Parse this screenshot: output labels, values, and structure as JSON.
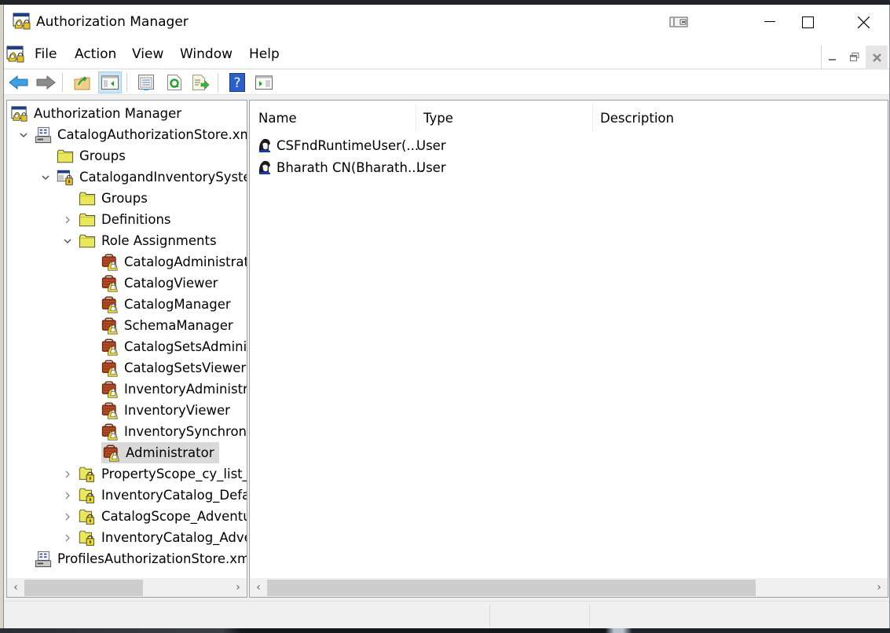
{
  "window": {
    "title": "Authorization Manager",
    "controls": {
      "snap": "snap-assist",
      "minimize": "minimize",
      "maximize": "maximize",
      "close": "close"
    }
  },
  "menubar": {
    "items": [
      "File",
      "Action",
      "View",
      "Window",
      "Help"
    ]
  },
  "toolbar": {
    "buttons": [
      {
        "name": "back",
        "icon": "back-arrow-icon"
      },
      {
        "name": "forward",
        "icon": "forward-arrow-icon"
      },
      {
        "name": "up-one-level",
        "icon": "folder-up-icon"
      },
      {
        "name": "show-hide-console-tree",
        "icon": "console-tree-icon",
        "active": true
      },
      {
        "name": "properties",
        "icon": "properties-icon"
      },
      {
        "name": "refresh",
        "icon": "refresh-icon"
      },
      {
        "name": "export-list",
        "icon": "export-list-icon"
      },
      {
        "name": "help",
        "icon": "help-icon"
      },
      {
        "name": "show-hide-action-pane",
        "icon": "action-pane-icon"
      }
    ]
  },
  "tree": {
    "nodes": [
      {
        "label": "Authorization Manager",
        "level": 0,
        "icon": "azman-icon",
        "expander": "none"
      },
      {
        "label": "CatalogAuthorizationStore.xml",
        "level": 1,
        "icon": "store-icon",
        "expander": "expanded"
      },
      {
        "label": "Groups",
        "level": 2,
        "icon": "folder-icon",
        "expander": "none"
      },
      {
        "label": "CatalogandInventorySystem",
        "level": 2,
        "icon": "application-icon",
        "expander": "expanded"
      },
      {
        "label": "Groups",
        "level": 3,
        "icon": "folder-icon",
        "expander": "none"
      },
      {
        "label": "Definitions",
        "level": 3,
        "icon": "folder-icon",
        "expander": "collapsed"
      },
      {
        "label": "Role Assignments",
        "level": 3,
        "icon": "folder-icon",
        "expander": "expanded"
      },
      {
        "label": "CatalogAdministrator",
        "level": 4,
        "icon": "role-icon",
        "expander": "none"
      },
      {
        "label": "CatalogViewer",
        "level": 4,
        "icon": "role-icon",
        "expander": "none"
      },
      {
        "label": "CatalogManager",
        "level": 4,
        "icon": "role-icon",
        "expander": "none"
      },
      {
        "label": "SchemaManager",
        "level": 4,
        "icon": "role-icon",
        "expander": "none"
      },
      {
        "label": "CatalogSetsAdministrator",
        "level": 4,
        "icon": "role-icon",
        "expander": "none"
      },
      {
        "label": "CatalogSetsViewer",
        "level": 4,
        "icon": "role-icon",
        "expander": "none"
      },
      {
        "label": "InventoryAdministrator",
        "level": 4,
        "icon": "role-icon",
        "expander": "none"
      },
      {
        "label": "InventoryViewer",
        "level": 4,
        "icon": "role-icon",
        "expander": "none"
      },
      {
        "label": "InventorySynchronization",
        "level": 4,
        "icon": "role-icon",
        "expander": "none"
      },
      {
        "label": "Administrator",
        "level": 4,
        "icon": "role-icon",
        "expander": "none",
        "selected": true
      },
      {
        "label": "PropertyScope_cy_list_p",
        "level": 3,
        "icon": "scope-icon",
        "expander": "collapsed"
      },
      {
        "label": "InventoryCatalog_Default",
        "level": 3,
        "icon": "scope-icon",
        "expander": "collapsed"
      },
      {
        "label": "CatalogScope_Adventure",
        "level": 3,
        "icon": "scope-icon",
        "expander": "collapsed"
      },
      {
        "label": "InventoryCatalog_Adventure",
        "level": 3,
        "icon": "scope-icon",
        "expander": "collapsed"
      },
      {
        "label": "ProfilesAuthorizationStore.xml",
        "level": 1,
        "icon": "store-icon",
        "expander": "none"
      }
    ]
  },
  "list": {
    "columns": [
      "Name",
      "Type",
      "Description"
    ],
    "rows": [
      {
        "name": "CSFndRuntimeUser(...",
        "type": "User",
        "description": "",
        "icon": "user-icon"
      },
      {
        "name": "Bharath CN(Bharath....",
        "type": "User",
        "description": "",
        "icon": "user-icon"
      }
    ]
  },
  "scrollbars": {
    "tree_h": {
      "thumb_fraction": 0.58,
      "position": 0.0
    },
    "list_h": {
      "thumb_fraction": 0.81,
      "position": 0.0
    }
  },
  "colors": {
    "selection": "#d9d9d9",
    "toolbar_active": "#cce4f7",
    "folder": "#e8e85a"
  }
}
